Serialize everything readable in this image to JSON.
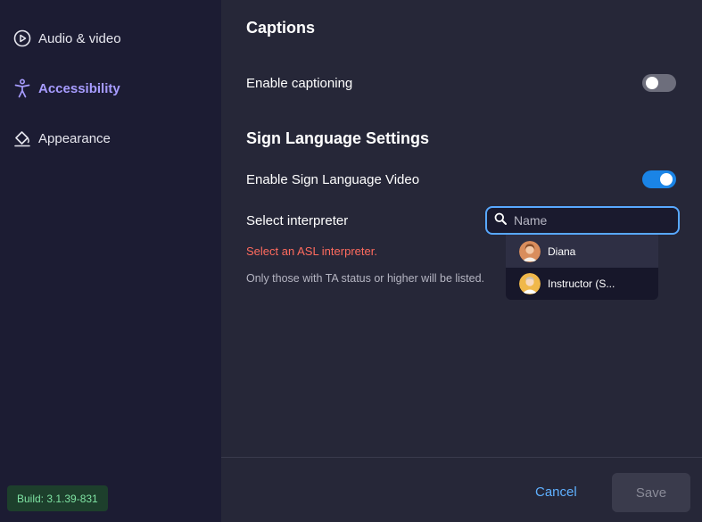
{
  "sidebar": {
    "items": [
      {
        "label": "Audio & video",
        "icon": "play-circle-icon",
        "active": false
      },
      {
        "label": "Accessibility",
        "icon": "accessibility-icon",
        "active": true
      },
      {
        "label": "Appearance",
        "icon": "paint-bucket-icon",
        "active": false
      }
    ],
    "build": "Build: 3.1.39-831"
  },
  "captions": {
    "title": "Captions",
    "enable_label": "Enable captioning",
    "enabled": false
  },
  "sign_language": {
    "title": "Sign Language Settings",
    "enable_label": "Enable Sign Language Video",
    "enabled": true,
    "select_label": "Select interpreter",
    "error": "Select an ASL interpreter.",
    "hint": "Only those with TA status or higher will be listed.",
    "search_placeholder": "Name",
    "options": [
      {
        "name": "Diana"
      },
      {
        "name": "Instructor (S..."
      }
    ]
  },
  "footer": {
    "cancel_label": "Cancel",
    "save_label": "Save"
  },
  "colors": {
    "accent": "#a79cff",
    "toggle_on": "#1a84e6",
    "error": "#ff6b5e",
    "link": "#5fb0ff"
  }
}
